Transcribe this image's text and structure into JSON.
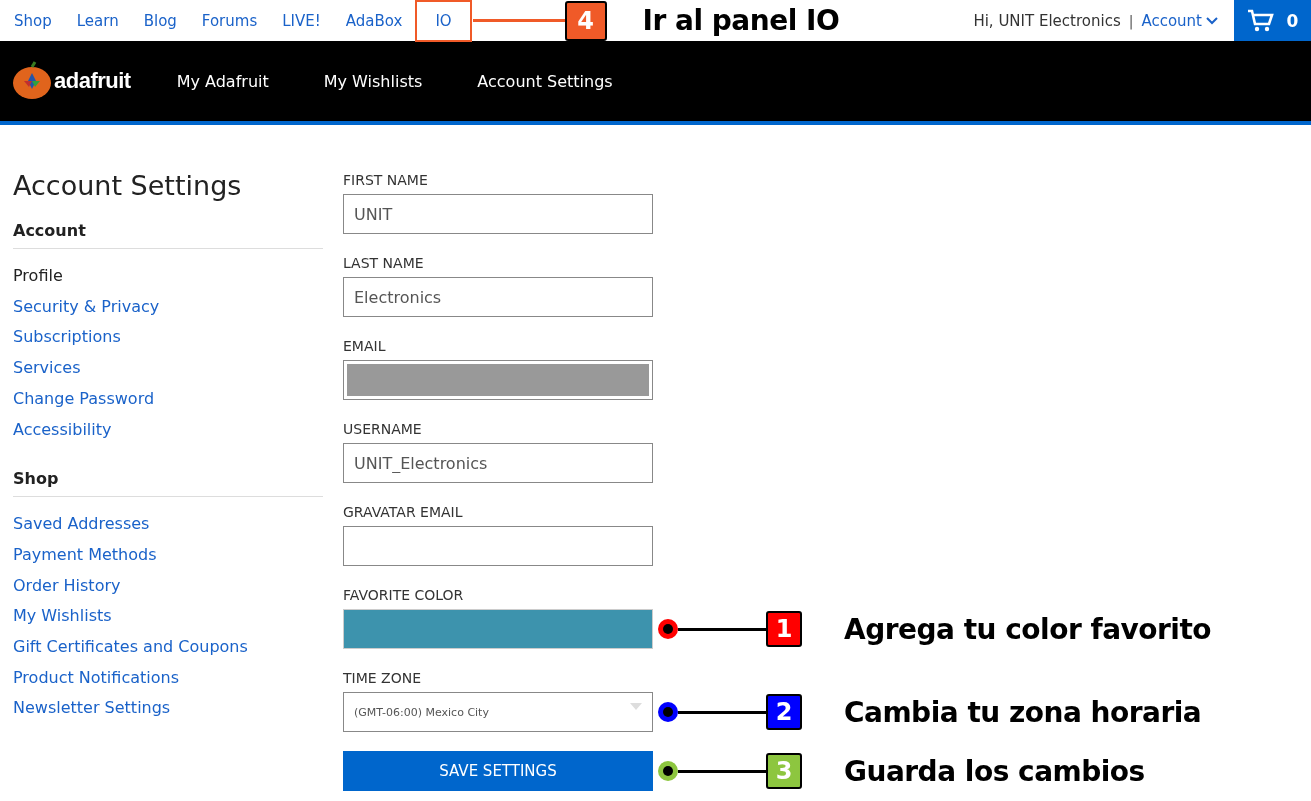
{
  "top_links": [
    {
      "label": "Shop",
      "highlighted": false
    },
    {
      "label": "Learn",
      "highlighted": false
    },
    {
      "label": "Blog",
      "highlighted": false
    },
    {
      "label": "Forums",
      "highlighted": false
    },
    {
      "label": "LIVE!",
      "highlighted": false
    },
    {
      "label": "AdaBox",
      "highlighted": false
    },
    {
      "label": "IO",
      "highlighted": true
    }
  ],
  "top_callout": {
    "number": "4",
    "text": "Ir al panel IO",
    "color": "#f05a28"
  },
  "greeting": "Hi, UNIT Electronics",
  "separator": "|",
  "account_menu": "Account",
  "cart": {
    "count": "0"
  },
  "logo": {
    "text": "adafruit"
  },
  "main_nav": [
    "My Adafruit",
    "My Wishlists",
    "Account Settings"
  ],
  "sidebar": {
    "title": "Account Settings",
    "sections": [
      {
        "heading": "Account",
        "items": [
          {
            "label": "Profile",
            "selected": true
          },
          {
            "label": "Security & Privacy",
            "selected": false
          },
          {
            "label": "Subscriptions",
            "selected": false
          },
          {
            "label": "Services",
            "selected": false
          },
          {
            "label": "Change Password",
            "selected": false
          },
          {
            "label": "Accessibility",
            "selected": false
          }
        ]
      },
      {
        "heading": "Shop",
        "items": [
          {
            "label": "Saved Addresses",
            "selected": false
          },
          {
            "label": "Payment Methods",
            "selected": false
          },
          {
            "label": "Order History",
            "selected": false
          },
          {
            "label": "My Wishlists",
            "selected": false
          },
          {
            "label": "Gift Certificates and Coupons",
            "selected": false
          },
          {
            "label": "Product Notifications",
            "selected": false
          },
          {
            "label": "Newsletter Settings",
            "selected": false
          }
        ]
      }
    ]
  },
  "fields": [
    {
      "kind": "text",
      "label": "FIRST NAME",
      "value": "UNIT"
    },
    {
      "kind": "text",
      "label": "LAST NAME",
      "value": "Electronics"
    },
    {
      "kind": "redacted",
      "label": "EMAIL"
    },
    {
      "kind": "text",
      "label": "USERNAME",
      "value": "UNIT_Electronics"
    },
    {
      "kind": "text",
      "label": "GRAVATAR EMAIL"
    },
    {
      "kind": "color",
      "label": "FAVORITE COLOR",
      "color": "#3d93ad",
      "callout": {
        "number": "1",
        "text": "Agrega tu color favorito",
        "color": "#ff0000"
      }
    },
    {
      "kind": "select",
      "label": "TIME ZONE",
      "value": "(GMT-06:00) Mexico City",
      "callout": {
        "number": "2",
        "text": "Cambia tu zona horaria",
        "color": "#0000ff"
      }
    }
  ],
  "save_button": {
    "label": "SAVE SETTINGS",
    "callout": {
      "number": "3",
      "text": "Guarda los cambios",
      "color": "#8dc63f"
    }
  }
}
